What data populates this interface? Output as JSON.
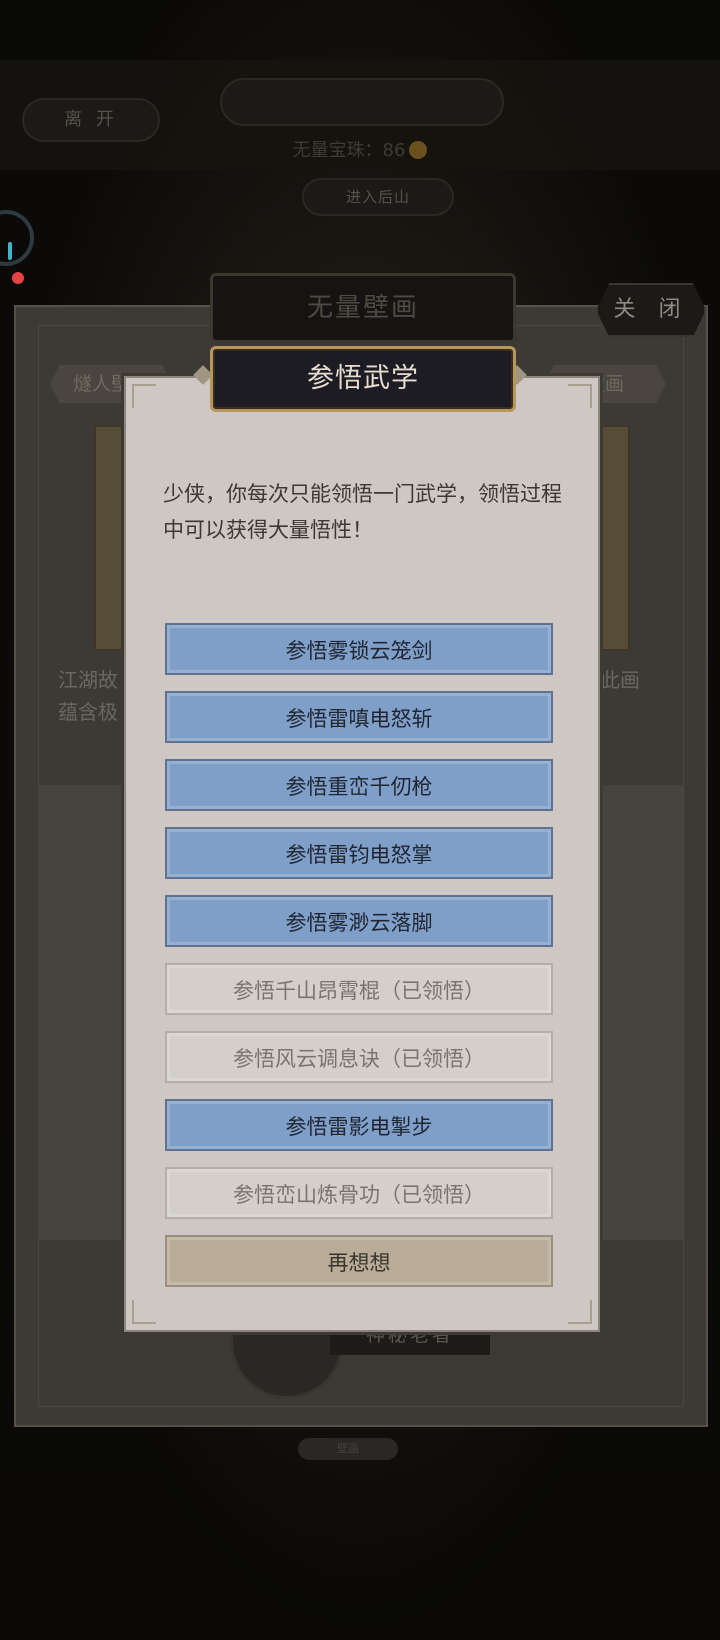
{
  "background": {
    "leave_label": "离 开",
    "treasure_text": "无量宝珠：86",
    "enter_label": "进入后山",
    "panel_title": "无量壁画",
    "close_label": "关 闭",
    "tab_left": "燧人壁画",
    "tab_right": "壁画",
    "desc_left": "江湖故\n蕴含极",
    "desc_right": "此画",
    "npc_label": "神秘老者",
    "bottom_label": "壁画"
  },
  "dialog": {
    "title": "参悟武学",
    "message": "少侠，你每次只能领悟一门武学，领悟过程中可以获得大量悟性！",
    "options": [
      {
        "label": "参悟雾锁云笼剑",
        "learned": false
      },
      {
        "label": "参悟雷嗔电怒斩",
        "learned": false
      },
      {
        "label": "参悟重峦千仞枪",
        "learned": false
      },
      {
        "label": "参悟雷钧电怒掌",
        "learned": false
      },
      {
        "label": "参悟雾渺云落脚",
        "learned": false
      },
      {
        "label": "参悟千山昂霄棍（已领悟）",
        "learned": true
      },
      {
        "label": "参悟风云调息诀（已领悟）",
        "learned": true
      },
      {
        "label": "参悟雷影电掣步",
        "learned": false
      },
      {
        "label": "参悟峦山炼骨功（已领悟）",
        "learned": true
      }
    ],
    "cancel_label": "再想想"
  },
  "colors": {
    "option_active": "#7f9fc9",
    "option_learned": "#d4cfcb",
    "cancel": "#b9ad99",
    "title_border": "#b8975a"
  }
}
